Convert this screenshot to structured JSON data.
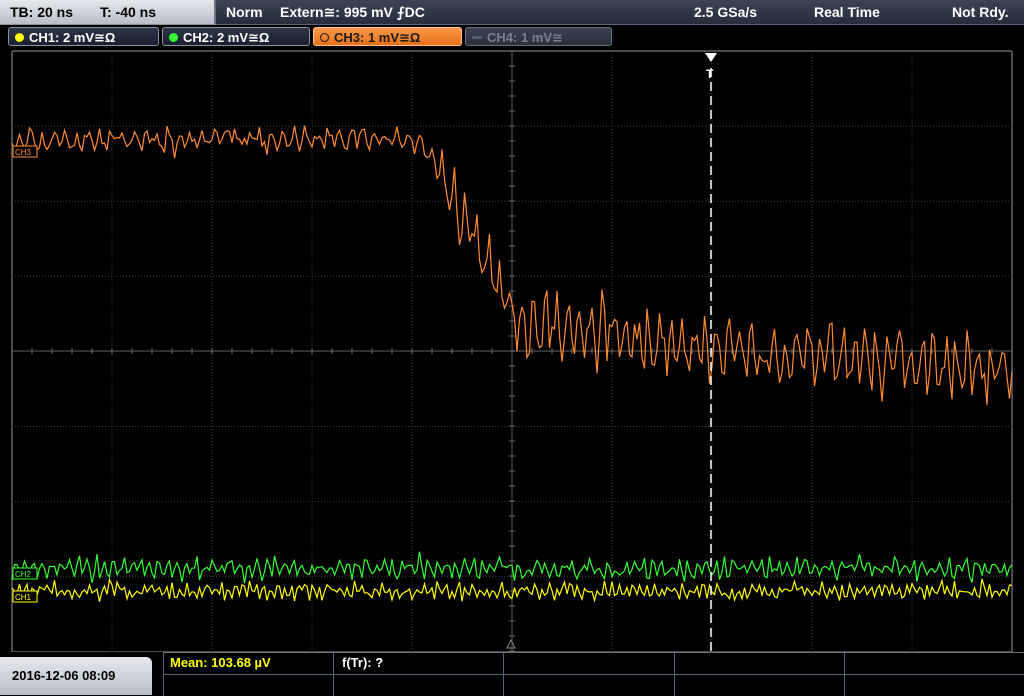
{
  "timebase": {
    "tb": "TB: 20 ns",
    "trigger_pos": "T: -40 ns"
  },
  "acquisition": {
    "mode": "Norm",
    "trigger_source": "Extern≅: 995 mV ⨍DC",
    "sample_rate": "2.5 GSa/s",
    "acq_mode": "Real Time",
    "status": "Not Rdy."
  },
  "channels": [
    {
      "label": "CH1: 2 mV≅Ω",
      "color": "#ffff00",
      "active": true
    },
    {
      "label": "CH2: 2 mV≅Ω",
      "color": "#33ff33",
      "active": true
    },
    {
      "label": "CH3: 1 mV≅Ω",
      "color": "#ff8c33",
      "active": true,
      "selected": true
    },
    {
      "label": "CH4: 1 mV≅",
      "color": "#7a8090",
      "active": false
    }
  ],
  "trace_markers": {
    "ch3": "CH3",
    "ch2": "CH2",
    "ch1": "CH1"
  },
  "trigger_marker": "T",
  "footer": {
    "datetime": "2016-12-06 08:09",
    "mean": "Mean: 103.68 µV",
    "rise_time": "f(Tr): ?"
  },
  "colors": {
    "grid": "#4a4a4a",
    "ch1": "#ffff00",
    "ch2": "#33ff33",
    "ch3": "#ff8c33"
  }
}
